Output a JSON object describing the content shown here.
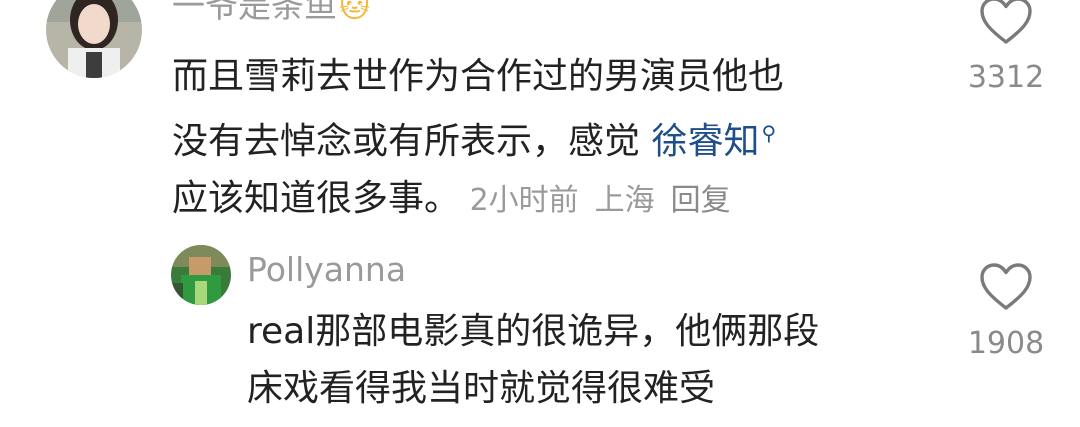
{
  "comments": [
    {
      "username": "一爷是条鱼",
      "username_emoji": "🐱",
      "text_lines": [
        "而且雪莉去世作为合作过的男演员他也",
        "没有去悼念或有所表示，感觉 "
      ],
      "mention": "徐睿知",
      "mention_icon": "search-icon",
      "text_tail": "应该知道很多事。",
      "time": "2小时前",
      "location": "上海",
      "reply_label": "回复",
      "likes": "3312"
    },
    {
      "username": "Pollyanna",
      "text_lines": [
        "real那部电影真的很诡异，他俩那段",
        "床戏看得我当时就觉得很难受"
      ],
      "likes": "1908"
    }
  ],
  "colors": {
    "text": "#222222",
    "muted": "#9a9a9a",
    "mention": "#1f4f8a"
  }
}
